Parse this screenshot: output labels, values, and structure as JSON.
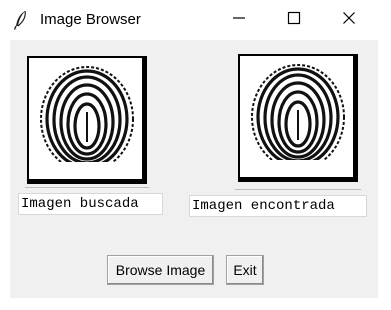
{
  "window": {
    "title": "Image Browser",
    "controls": {
      "minimize_icon": "minimize-icon",
      "maximize_icon": "maximize-icon",
      "close_icon": "close-icon"
    }
  },
  "images": {
    "searched": {
      "icon": "fingerprint-image"
    },
    "found": {
      "icon": "fingerprint-image"
    }
  },
  "fields": {
    "searched_value": "Imagen buscada",
    "found_value": "Imagen encontrada"
  },
  "buttons": {
    "browse_label": "Browse Image",
    "exit_label": "Exit"
  },
  "colors": {
    "titlebar": "#ffffff",
    "client_bg": "#f0f0f0",
    "field_bg": "#ffffff"
  }
}
